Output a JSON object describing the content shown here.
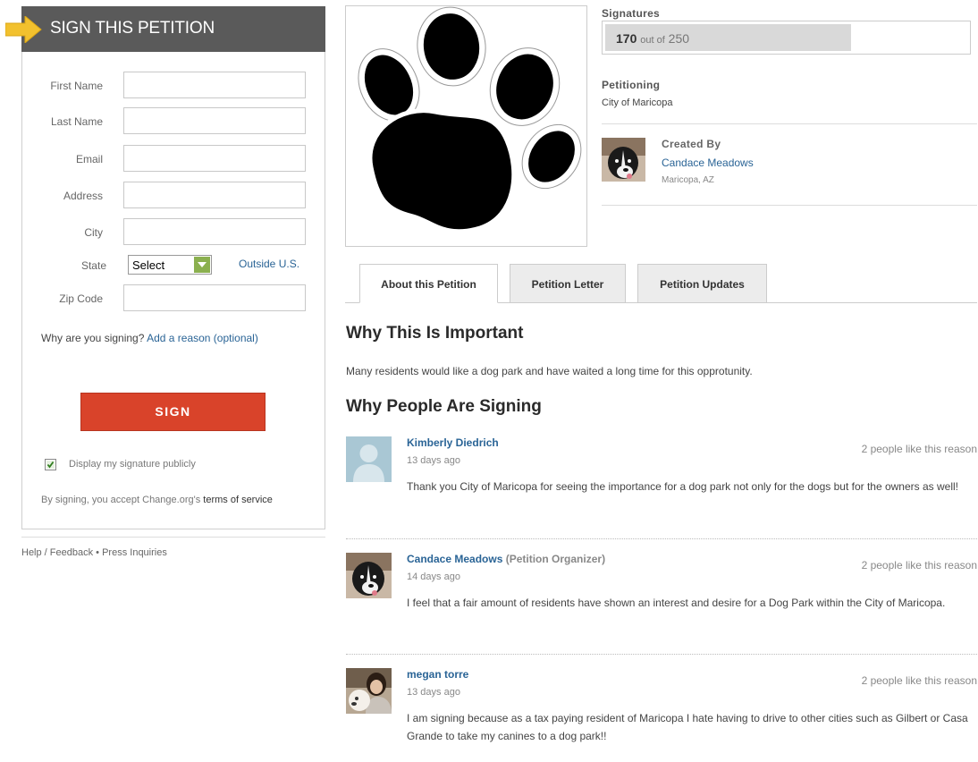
{
  "sign_form": {
    "header_title": "SIGN THIS PETITION",
    "fields": {
      "first_name": "First Name",
      "last_name": "Last Name",
      "email": "Email",
      "address": "Address",
      "city": "City",
      "state": "State",
      "zip": "Zip Code"
    },
    "state_value": "Select",
    "outside_link": "Outside U.S.",
    "why_prefix": "Why are you signing?",
    "why_link": "Add a reason (optional)",
    "sign_button": "SIGN",
    "display_label": "Display my signature publicly",
    "display_checked": true,
    "terms_prefix": "By signing, you accept Change.org's",
    "terms_link": "terms of service"
  },
  "footer": {
    "help": "Help / Feedback",
    "sep": "•",
    "press": "Press Inquiries"
  },
  "signatures": {
    "label": "Signatures",
    "count": "170",
    "of": "out of",
    "goal": "250",
    "progress": 0.68
  },
  "petitioning": {
    "label": "Petitioning",
    "target": "City of Maricopa"
  },
  "creator": {
    "label": "Created By",
    "name": "Candace Meadows",
    "location": "Maricopa, AZ"
  },
  "tabs": [
    {
      "label": "About this Petition",
      "active": true
    },
    {
      "label": "Petition Letter",
      "active": false
    },
    {
      "label": "Petition Updates",
      "active": false
    }
  ],
  "why_important": {
    "title": "Why This Is Important",
    "text": "Many residents would like a dog park and have waited a long time for this opprotunity."
  },
  "why_signing": {
    "title": "Why People Are Signing",
    "reasons": [
      {
        "name": "Kimberly Diedrich",
        "role": "",
        "date": "13 days ago",
        "likes": "2 people like this reason",
        "text": "Thank you City of Maricopa for seeing the importance for a dog park not only for the dogs but for the owners as well!"
      },
      {
        "name": "Candace Meadows",
        "role": "(Petition Organizer)",
        "date": "14 days ago",
        "likes": "2 people like this reason",
        "text": "I feel that a fair amount of residents have shown an interest and desire for a Dog Park within the City of Maricopa."
      },
      {
        "name": "megan torre",
        "role": "",
        "date": "13 days ago",
        "likes": "2 people like this reason",
        "text": "I am signing because as a tax paying resident of Maricopa I hate having to drive to other cities such as Gilbert or Casa Grande to take my canines to a dog park!!"
      }
    ]
  }
}
